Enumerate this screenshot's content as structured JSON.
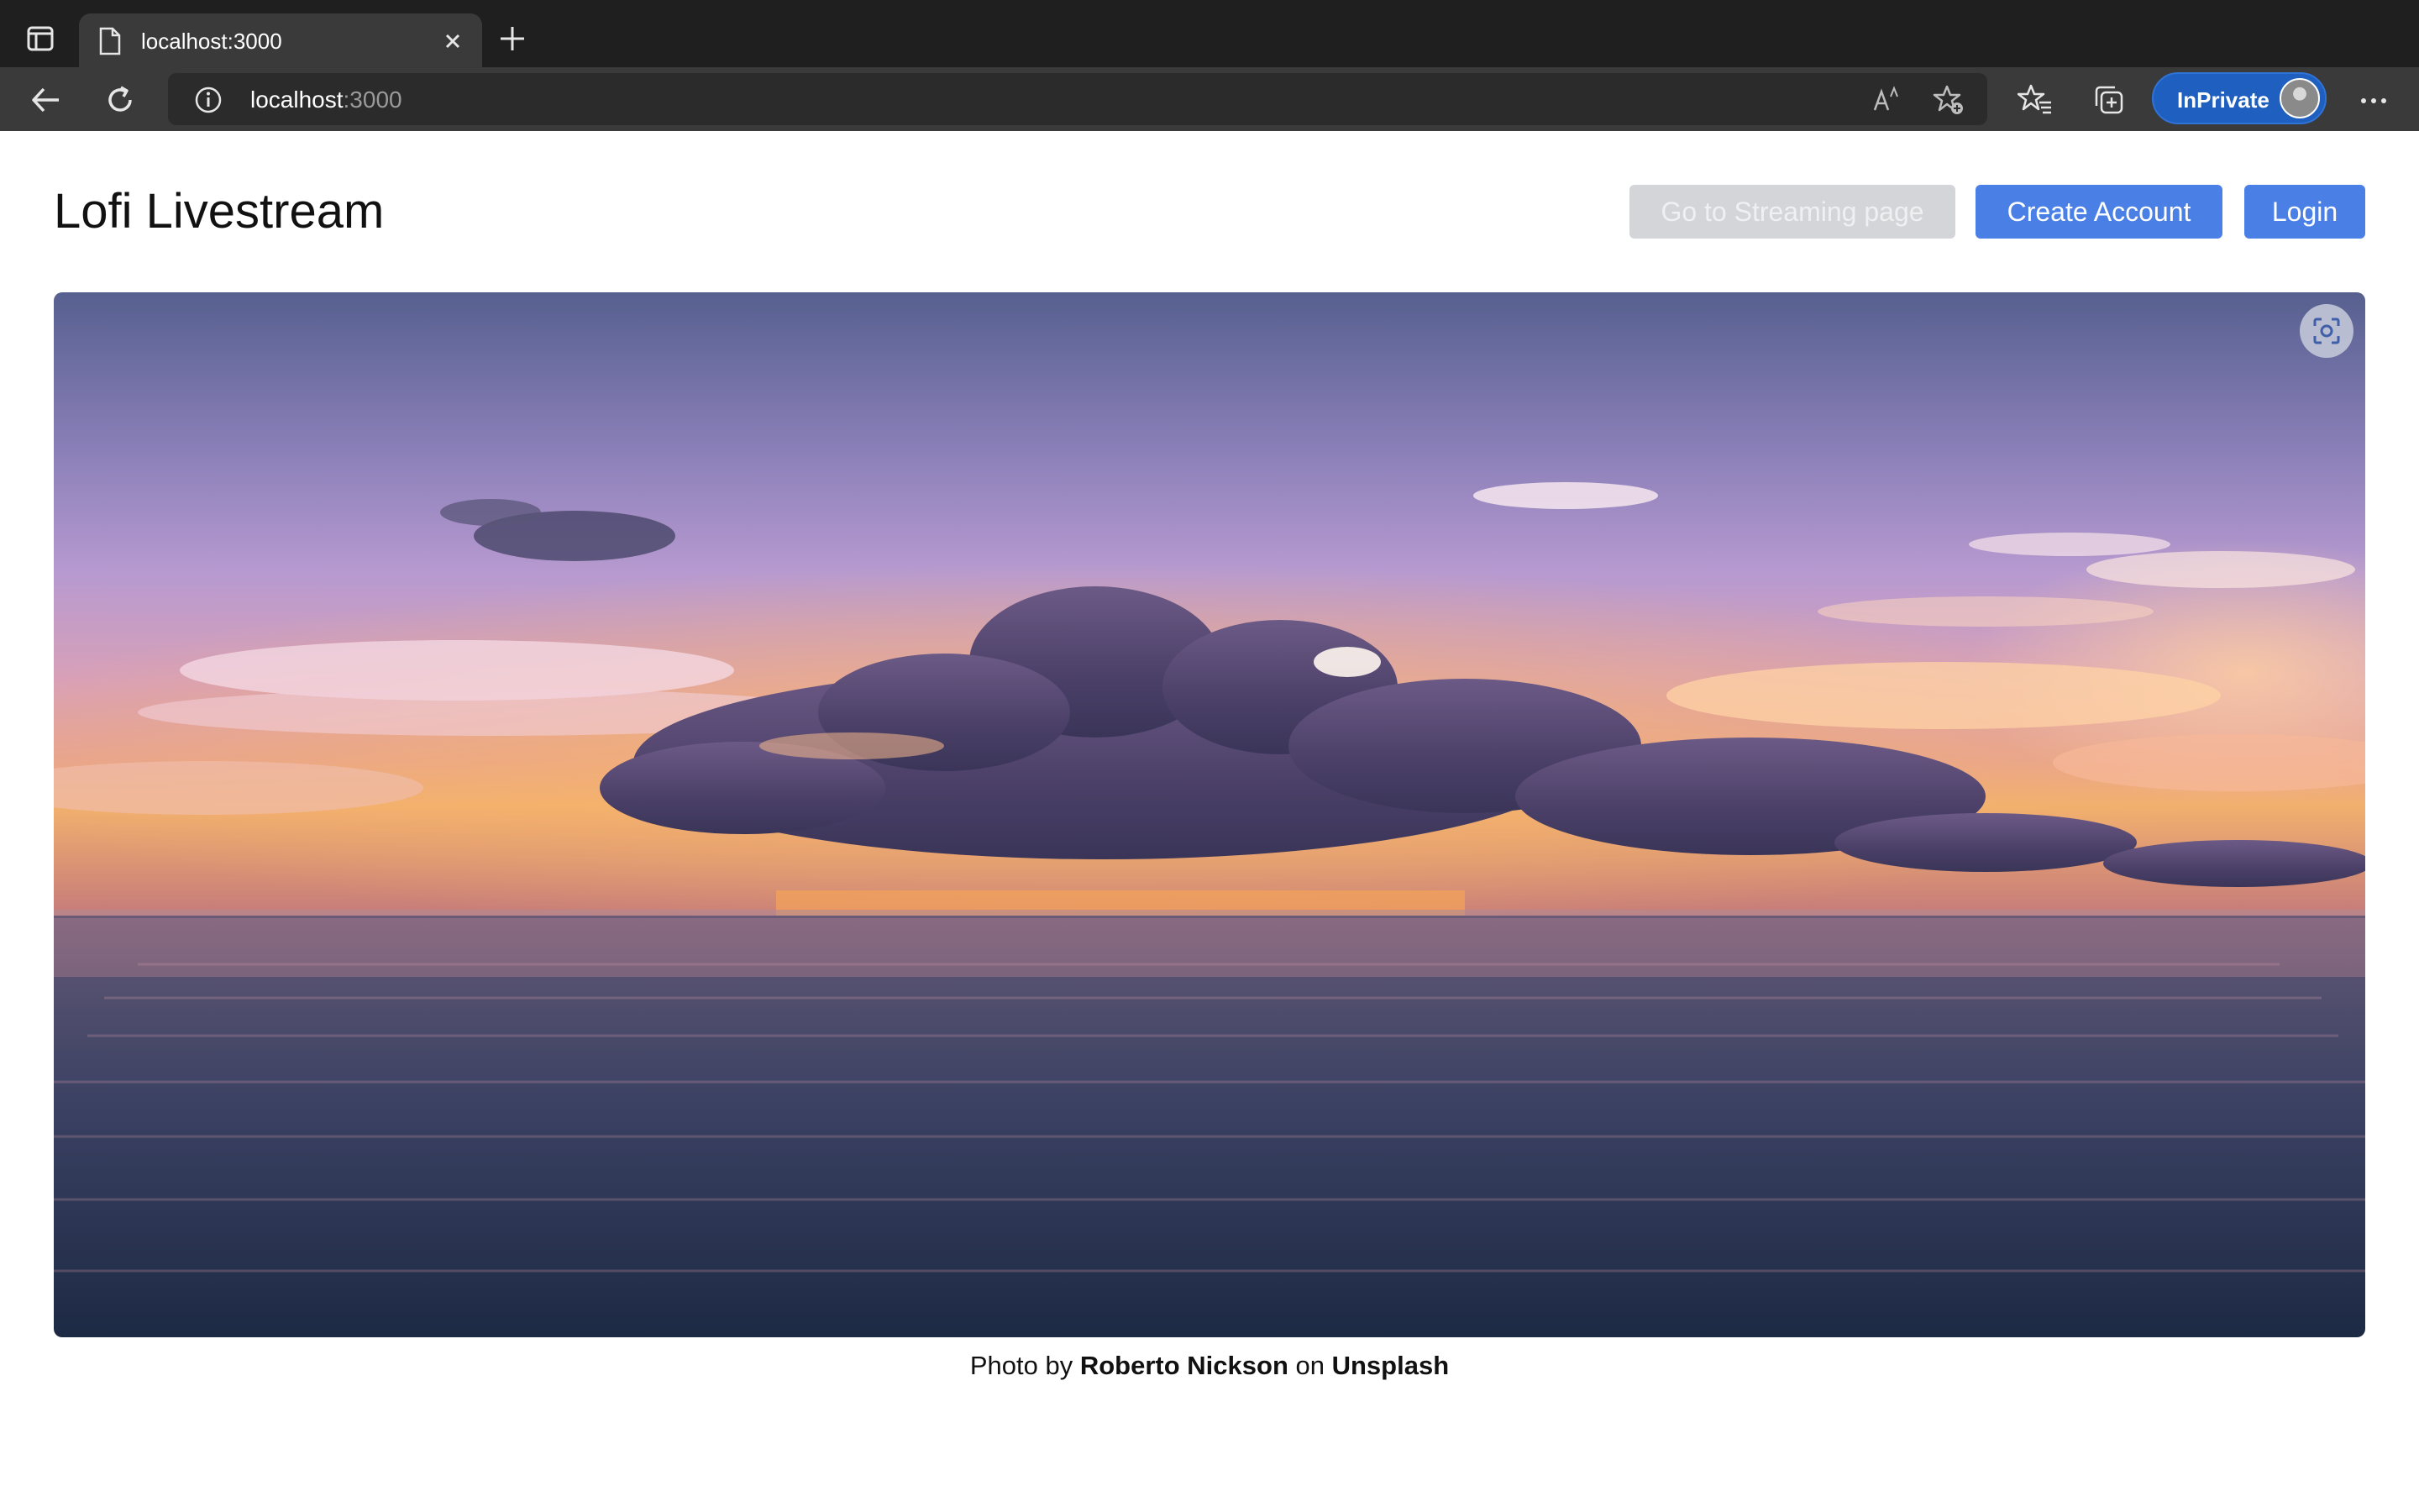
{
  "browser": {
    "tab": {
      "title": "localhost:3000"
    },
    "address": {
      "host": "localhost",
      "port": ":3000"
    },
    "profile_label": "InPrivate",
    "icons": {
      "sidebar": "sidebar-toggle-icon",
      "tab_favicon": "page-icon",
      "tab_close": "close-icon",
      "new_tab": "plus-icon",
      "back": "back-arrow-icon",
      "refresh": "refresh-icon",
      "info": "info-icon",
      "read_aloud": "read-aloud-icon",
      "add_favorite": "star-plus-icon",
      "favorites": "favorites-icon",
      "collections": "collections-icon",
      "more": "more-icon"
    }
  },
  "page": {
    "title": "Lofi Livestream",
    "buttons": {
      "streaming": "Go to Streaming page",
      "create_account": "Create Account",
      "login": "Login"
    },
    "caption": {
      "prefix": "Photo by ",
      "author": "Roberto Nickson",
      "middle": " on ",
      "source": "Unsplash"
    }
  },
  "colors": {
    "chrome_dark": "#1f1f1f",
    "chrome_toolbar": "#3a3a3a",
    "accent": "#4a7fe6",
    "disabled_button": "#d3d5d8",
    "inprivate": "#1f5fbf"
  }
}
